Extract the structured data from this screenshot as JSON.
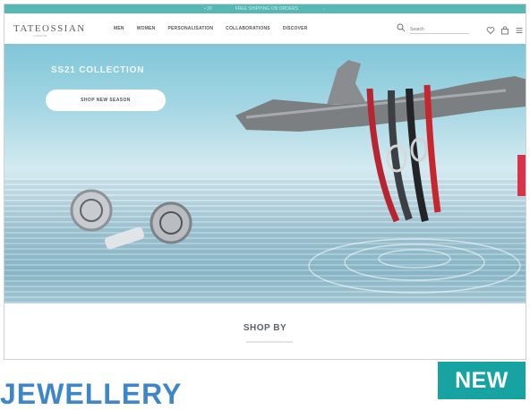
{
  "topbar": {
    "items": [
      "• 20",
      "FREE SHIPPING ON ORDERS",
      "→"
    ]
  },
  "header": {
    "logo": "TATEOSSIAN",
    "logo_sub": "LONDON",
    "nav": [
      "MEN",
      "WOMEN",
      "PERSONALISATION",
      "COLLABORATIONS",
      "DISCOVER"
    ],
    "search_placeholder": "Search"
  },
  "hero": {
    "title": "SS21 COLLECTION",
    "cta_label": "SHOP NEW SEASON"
  },
  "shop_by": {
    "title": "SHOP BY"
  },
  "badge": {
    "label": "NEW"
  },
  "caption": {
    "text": "JEWELLERY"
  },
  "colors": {
    "accent": "#16a3a1",
    "topbar": "#56b8b3",
    "side_tab": "#d9334a",
    "caption": "#3f86c8"
  },
  "icons": [
    "search-icon",
    "heart-icon",
    "bag-icon",
    "menu-icon"
  ]
}
